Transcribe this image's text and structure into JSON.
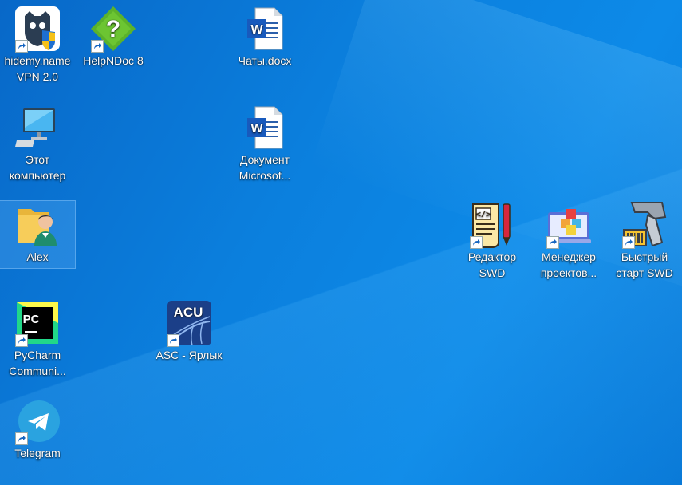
{
  "desktop": {
    "icons": [
      {
        "label": "hidemy.name\nVPN 2.0",
        "icon": "hidemy-vpn-icon",
        "shortcut": true
      },
      {
        "label": "HelpNDoc 8",
        "icon": "helpndoc-icon",
        "shortcut": true
      },
      {
        "label": "Чаты.docx",
        "icon": "word-document-icon",
        "shortcut": false
      },
      {
        "label": "Этот\nкомпьютер",
        "icon": "computer-icon",
        "shortcut": false
      },
      {
        "label": "Документ\nMicrosof...",
        "icon": "word-document-icon",
        "shortcut": false
      },
      {
        "label": "Alex",
        "icon": "user-folder-icon",
        "shortcut": false,
        "selected": true
      },
      {
        "label": "Редактор\nSWD",
        "icon": "swd-editor-icon",
        "shortcut": true
      },
      {
        "label": "Менеджер\nпроектов...",
        "icon": "project-manager-icon",
        "shortcut": true
      },
      {
        "label": "Быстрый\nстарт SWD",
        "icon": "barcode-scanner-icon",
        "shortcut": true
      },
      {
        "label": "PyCharm\nCommuni...",
        "icon": "pycharm-icon",
        "shortcut": true
      },
      {
        "label": "ASC - Ярлык",
        "icon": "asc-icon",
        "shortcut": true
      },
      {
        "label": "Telegram",
        "icon": "telegram-icon",
        "shortcut": true
      }
    ]
  },
  "colors": {
    "desktop_background": "#0a79d8",
    "label_text": "#ffffff"
  }
}
